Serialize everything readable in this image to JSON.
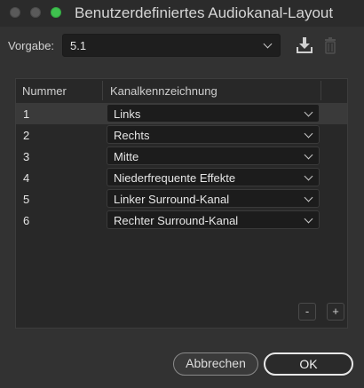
{
  "window": {
    "title": "Benutzerdefiniertes Audiokanal-Layout"
  },
  "preset": {
    "label": "Vorgabe:",
    "value": "5.1"
  },
  "table": {
    "headers": [
      "Nummer",
      "Kanalkennzeichnung"
    ],
    "rows": [
      {
        "number": "1",
        "label": "Links"
      },
      {
        "number": "2",
        "label": "Rechts"
      },
      {
        "number": "3",
        "label": "Mitte"
      },
      {
        "number": "4",
        "label": "Niederfrequente Effekte"
      },
      {
        "number": "5",
        "label": "Linker Surround-Kanal"
      },
      {
        "number": "6",
        "label": "Rechter Surround-Kanal"
      }
    ],
    "selected_row": 0
  },
  "buttons": {
    "remove_label": "-",
    "add_label": "+",
    "cancel_label": "Abbrechen",
    "ok_label": "OK"
  },
  "icons": {
    "save": "download-save-icon",
    "delete": "trash-icon"
  }
}
